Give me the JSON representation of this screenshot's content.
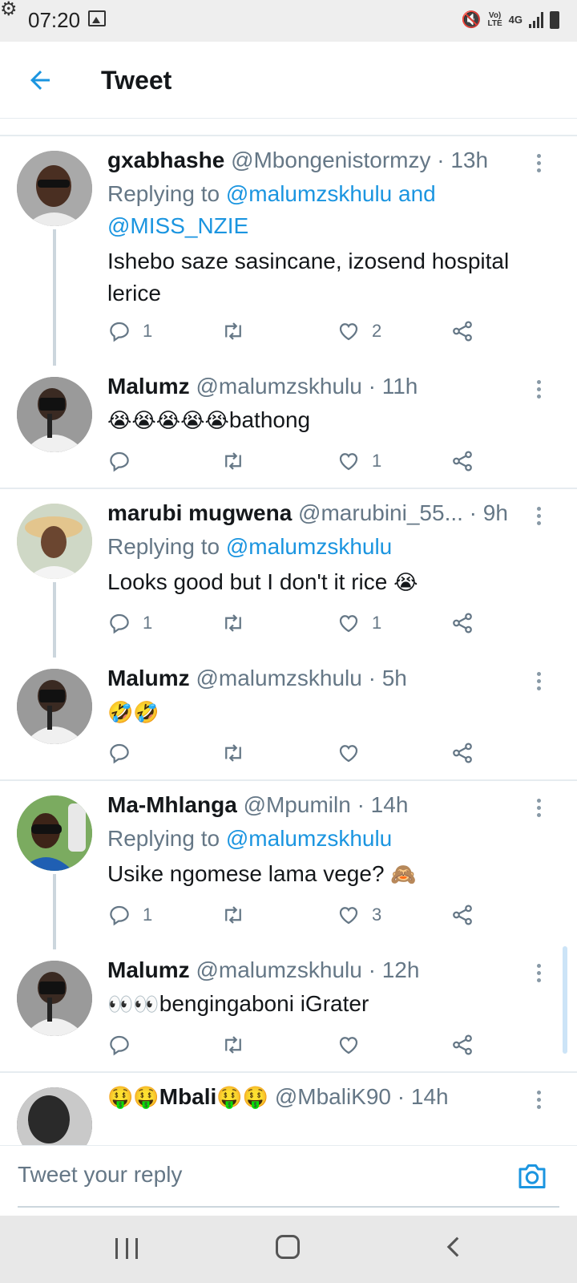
{
  "status_bar": {
    "time": "07:20",
    "lte_top": "Vo)",
    "lte_bottom": "LTE",
    "network": "4G"
  },
  "header": {
    "title": "Tweet"
  },
  "tweets": [
    {
      "name": "gxabhashe",
      "handle": "@Mbongenistormzy · 13h",
      "replying_prefix": "Replying to ",
      "replying_mentions": "@malumzskhulu and @MISS_NZIE",
      "text": "Ishebo saze sasincane, izosend hospital lerice",
      "reply_count": "1",
      "retweet_count": "",
      "like_count": "2"
    },
    {
      "name": "Malumz",
      "handle": "@malumzskhulu · 11h",
      "emoji": "😭😭😭😭😭",
      "text": "bathong",
      "reply_count": "",
      "retweet_count": "",
      "like_count": "1"
    },
    {
      "name": "marubi mugwena",
      "handle": "@marubini_55... · 9h",
      "replying_prefix": "Replying to ",
      "replying_mentions": "@malumzskhulu",
      "text": "Looks good but I don't it rice",
      "emoji": "😭",
      "reply_count": "1",
      "retweet_count": "",
      "like_count": "1"
    },
    {
      "name": "Malumz",
      "handle": "@malumzskhulu · 5h",
      "emoji": "🤣🤣",
      "reply_count": "",
      "retweet_count": "",
      "like_count": ""
    },
    {
      "name": "Ma-Mhlanga",
      "handle": "@Mpumiln · 14h",
      "replying_prefix": "Replying to ",
      "replying_mentions": "@malumzskhulu",
      "text": "Usike ngomese lama vege?",
      "emoji": "🙈",
      "reply_count": "1",
      "retweet_count": "",
      "like_count": "3"
    },
    {
      "name": "Malumz",
      "handle": "@malumzskhulu · 12h",
      "emoji": "👀👀",
      "text": "bengingaboni iGrater",
      "reply_count": "",
      "retweet_count": "",
      "like_count": ""
    },
    {
      "name_emoji_left": "🤑🤑",
      "name": "Mbali",
      "name_emoji_right": "🤑🤑",
      "handle": "@MbaliK90 · 14h"
    }
  ],
  "reply_bar": {
    "placeholder": "Tweet your reply"
  },
  "colors": {
    "accent": "#1b95e0",
    "muted": "#657786",
    "border": "#e6ecf0"
  },
  "icons": [
    "back-arrow-icon",
    "reply-icon",
    "retweet-icon",
    "like-icon",
    "share-icon",
    "more-icon",
    "camera-icon"
  ]
}
